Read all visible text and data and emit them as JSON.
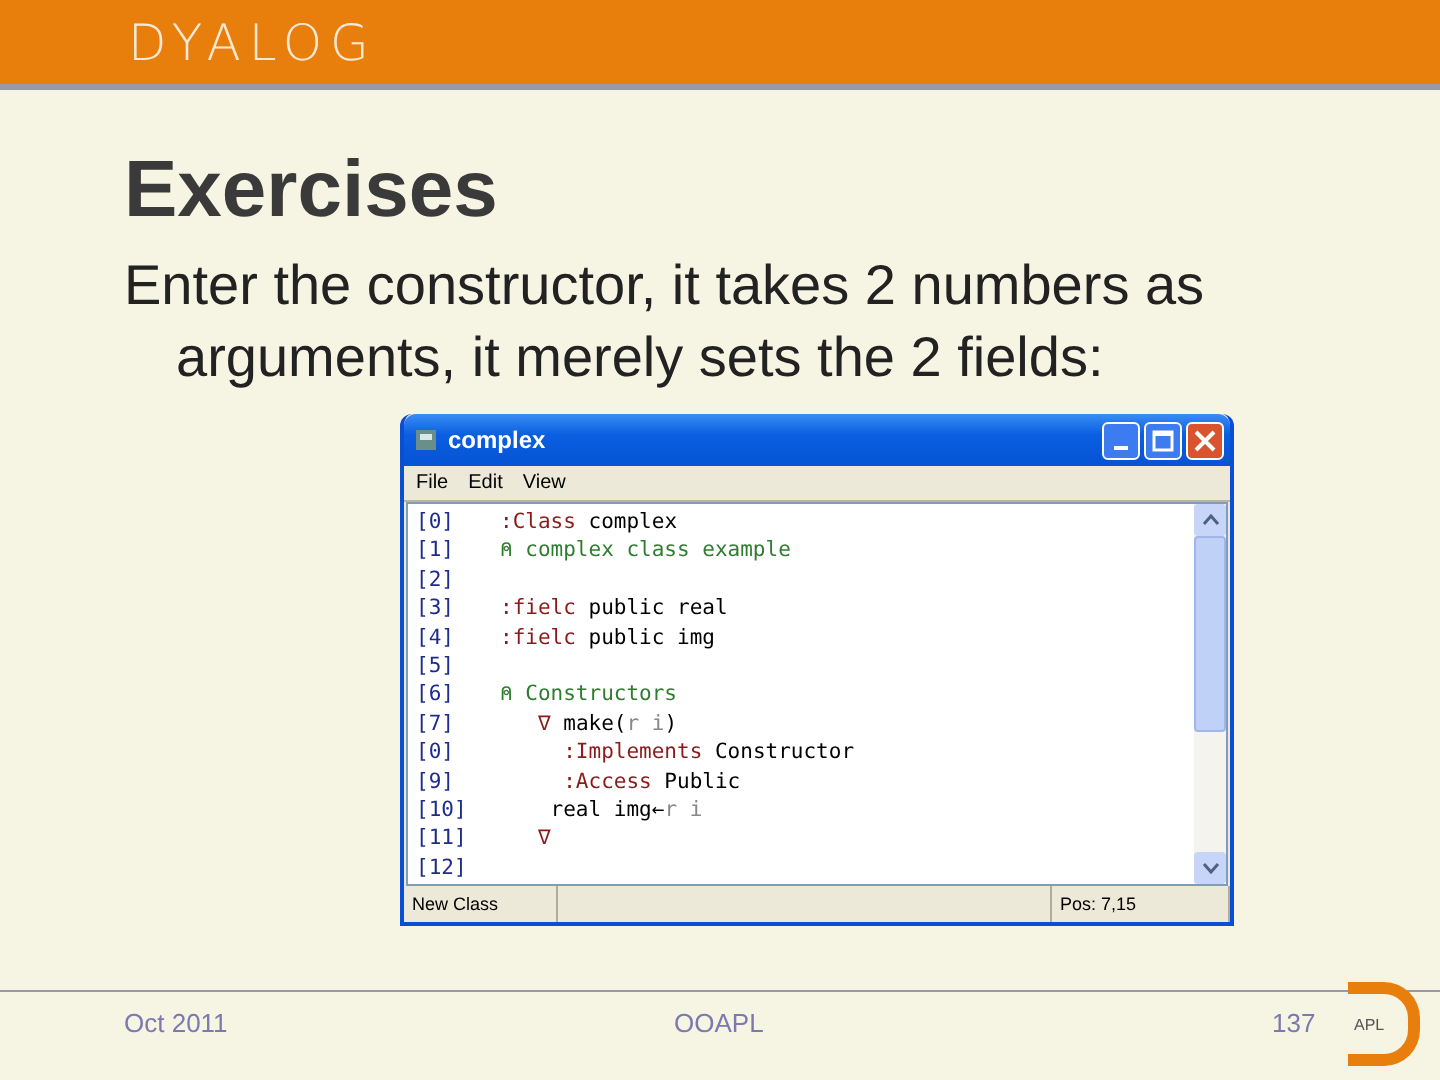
{
  "header": {
    "logo": "DYALOG"
  },
  "slide": {
    "title": "Exercises",
    "body": "Enter the constructor, it takes 2 numbers as arguments, it merely sets the 2 fields:"
  },
  "window": {
    "title": "complex",
    "menu": [
      "File",
      "Edit",
      "View"
    ],
    "lines": [
      {
        "number": "[0]",
        "segments": [
          {
            "kind": "keyword",
            "text": ":Class"
          },
          {
            "kind": "plain",
            "text": " complex"
          }
        ]
      },
      {
        "number": "[1]",
        "segments": [
          {
            "kind": "comment",
            "text": "⍝ complex class example"
          }
        ]
      },
      {
        "number": "[2]"
      },
      {
        "number": "[3]",
        "segments": [
          {
            "kind": "keyword",
            "text": ":fielc"
          },
          {
            "kind": "plain",
            "text": " public real"
          }
        ]
      },
      {
        "number": "[4]",
        "segments": [
          {
            "kind": "keyword",
            "text": ":fielc"
          },
          {
            "kind": "plain",
            "text": " public img"
          }
        ]
      },
      {
        "number": "[5]"
      },
      {
        "number": "[6]",
        "segments": [
          {
            "kind": "comment",
            "text": "⍝ Constructors"
          }
        ]
      },
      {
        "number": "[7]",
        "segments": [
          {
            "kind": "keyword",
            "text": "   ∇"
          },
          {
            "kind": "plain",
            "text": " make("
          },
          {
            "kind": "grey",
            "text": "r i"
          },
          {
            "kind": "plain",
            "text": ")"
          }
        ]
      },
      {
        "number": "[0]",
        "segments": [
          {
            "kind": "keyword",
            "text": "     :Implements"
          },
          {
            "kind": "plain",
            "text": " Constructor"
          }
        ]
      },
      {
        "number": "[9]",
        "segments": [
          {
            "kind": "keyword",
            "text": "     :Access"
          },
          {
            "kind": "plain",
            "text": " Public"
          }
        ]
      },
      {
        "number": "[10]",
        "segments": [
          {
            "kind": "plain",
            "text": "    real img←"
          },
          {
            "kind": "grey",
            "text": "r i"
          }
        ]
      },
      {
        "number": "[11]",
        "segments": [
          {
            "kind": "keyword",
            "text": "   ∇"
          }
        ]
      },
      {
        "number": "[12]"
      }
    ],
    "status": [
      "New Class",
      "Pos: 7,15"
    ]
  },
  "footer": {
    "date": "Oct 2011",
    "center": "OOAPL",
    "page": "137",
    "logo": "APL"
  }
}
